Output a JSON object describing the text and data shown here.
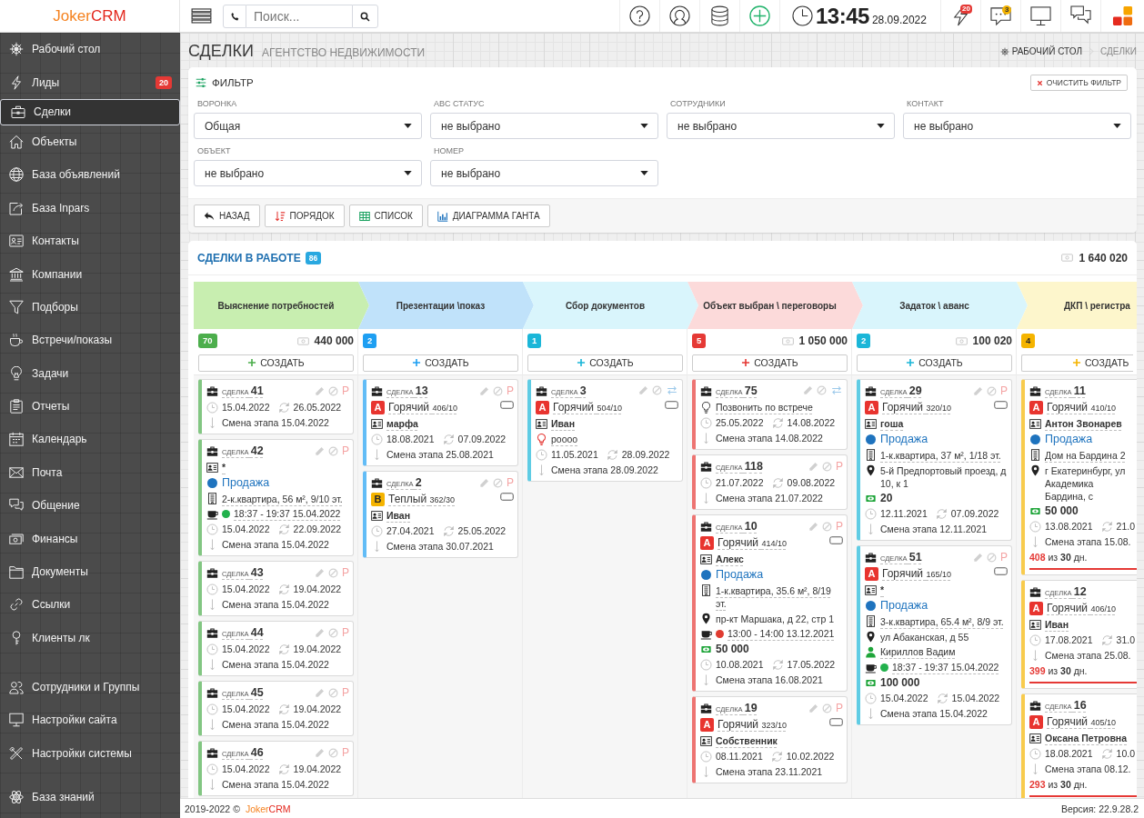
{
  "topbar": {
    "logo": [
      "Joker",
      "CRM"
    ],
    "search": {
      "placeholder": "Поиск..."
    },
    "clock": {
      "time": "13:45",
      "date": "28.09.2022"
    },
    "leads_badge": "20",
    "messages_badge": "3"
  },
  "sidebar": {
    "items": [
      {
        "label": "Рабочий стол",
        "selected": false
      },
      {
        "label": "Лиды",
        "selected": false,
        "badge": "20"
      },
      {
        "label": "Сделки",
        "selected": true
      },
      {
        "label": "Объекты",
        "selected": false
      },
      {
        "label": "База объявлений",
        "selected": false
      },
      {
        "label": "База Inpars",
        "selected": false
      },
      {
        "label": "Контакты",
        "selected": false
      },
      {
        "label": "Компании",
        "selected": false
      },
      {
        "label": "Подборы",
        "selected": false
      },
      {
        "label": "Встречи/показы",
        "selected": false
      },
      {
        "label": "Задачи",
        "selected": false
      },
      {
        "label": "Отчеты",
        "selected": false
      },
      {
        "label": "Календарь",
        "selected": false
      },
      {
        "label": "Почта",
        "selected": false
      },
      {
        "label": "Общение",
        "selected": false
      },
      {
        "label": "Финансы",
        "selected": false
      },
      {
        "label": "Документы",
        "selected": false
      },
      {
        "label": "Ссылки",
        "selected": false
      },
      {
        "label": "Клиенты лк",
        "selected": false
      }
    ],
    "admin_items": [
      {
        "label": "Сотрудники и Группы",
        "selected": false
      },
      {
        "label": "Настройки сайта",
        "selected": false
      },
      {
        "label": "Настройки системы",
        "selected": false
      }
    ],
    "bottom_items": [
      {
        "label": "База знаний",
        "selected": false
      }
    ]
  },
  "page": {
    "title": "СДЕЛКИ",
    "subtitle": "АГЕНТСТВО НЕДВИЖИМОСТИ",
    "breadcrumbs": [
      {
        "label": "РАБОЧИЙ СТОЛ",
        "current": false
      },
      {
        "label": "СДЕЛКИ",
        "current": true
      }
    ]
  },
  "filter": {
    "title": "ФИЛЬТР",
    "clear": "ОЧИСТИТЬ ФИЛЬТР",
    "fields": [
      {
        "label": "ВОРОНКА",
        "value": "Общая"
      },
      {
        "label": "ABC СТАТУС",
        "value": "не выбрано"
      },
      {
        "label": "СОТРУДНИКИ",
        "value": "не выбрано"
      },
      {
        "label": "КОНТАКТ",
        "value": "не выбрано"
      },
      {
        "label": "ОБЪЕКТ",
        "value": "не выбрано"
      },
      {
        "label": "НОМЕР",
        "value": "не выбрано"
      }
    ],
    "buttons": [
      "НАЗАД",
      "ПОРЯДОК",
      "СПИСОК",
      "ДИАГРАММА ГАНТА"
    ]
  },
  "deals": {
    "title": "СДЕЛКИ В РАБОТЕ",
    "count": "86",
    "total": "1 640 020",
    "stages": [
      {
        "name": "Выяснение потребностей",
        "color": "#c8eeb0",
        "count": {
          "text": "70",
          "color": "#4cae4c"
        },
        "total": "440 000",
        "create": "СОЗДАТЬ",
        "cards": [
          {
            "title": "СДЕЛКА",
            "number": "41",
            "actions": {
              "flag": "P"
            },
            "rows": [
              {
                "kind": "dates",
                "created": "15.04.2022",
                "updated": "26.05.2022"
              },
              {
                "kind": "stage",
                "text": "Смена этапа 15.04.2022"
              }
            ]
          },
          {
            "title": "СДЕЛКА",
            "number": "42",
            "actions": {
              "flag": "P"
            },
            "rows": [
              {
                "kind": "contact",
                "text": "*"
              },
              {
                "kind": "type",
                "text": "Продажа"
              },
              {
                "kind": "object",
                "text": "2-к.квартира, 56 м², 9/10 эт."
              },
              {
                "kind": "meeting",
                "text": "18:37 - 19:37 15.04.2022",
                "color": "#22b14c"
              },
              {
                "kind": "dates",
                "created": "15.04.2022",
                "updated": "22.09.2022"
              },
              {
                "kind": "stage",
                "text": "Смена этапа 15.04.2022"
              }
            ]
          },
          {
            "title": "СДЕЛКА",
            "number": "43",
            "actions": {
              "flag": "P"
            },
            "rows": [
              {
                "kind": "dates",
                "created": "15.04.2022",
                "updated": "19.04.2022"
              },
              {
                "kind": "stage",
                "text": "Смена этапа 15.04.2022"
              }
            ]
          },
          {
            "title": "СДЕЛКА",
            "number": "44",
            "actions": {
              "flag": "P"
            },
            "rows": [
              {
                "kind": "dates",
                "created": "15.04.2022",
                "updated": "19.04.2022"
              },
              {
                "kind": "stage",
                "text": "Смена этапа 15.04.2022"
              }
            ]
          },
          {
            "title": "СДЕЛКА",
            "number": "45",
            "actions": {
              "flag": "P"
            },
            "rows": [
              {
                "kind": "dates",
                "created": "15.04.2022",
                "updated": "19.04.2022"
              },
              {
                "kind": "stage",
                "text": "Смена этапа 15.04.2022"
              }
            ]
          },
          {
            "title": "СДЕЛКА",
            "number": "46",
            "actions": {
              "flag": "P"
            },
            "rows": [
              {
                "kind": "dates",
                "created": "15.04.2022",
                "updated": "19.04.2022"
              },
              {
                "kind": "stage",
                "text": "Смена этапа 15.04.2022"
              }
            ]
          }
        ]
      },
      {
        "name": "Презентации \\показ",
        "color": "#c0e2fa",
        "count": {
          "text": "2",
          "color": "#1e9ff2"
        },
        "create": "СОЗДАТЬ",
        "cards": [
          {
            "title": "СДЕЛКА",
            "number": "13",
            "actions": {
              "flag": "P"
            },
            "rows": [
              {
                "kind": "rating",
                "grade": "A",
                "label": "Горячий",
                "score": "406/10",
                "color": "#e8342f",
                "tag": true
              },
              {
                "kind": "contact",
                "text": "марфа"
              },
              {
                "kind": "dates",
                "created": "18.08.2021",
                "updated": "07.09.2022"
              },
              {
                "kind": "stage",
                "text": "Смена этапа 25.08.2021"
              }
            ]
          },
          {
            "title": "СДЕЛКА",
            "number": "2",
            "actions": {
              "flag": "P"
            },
            "rows": [
              {
                "kind": "rating",
                "grade": "B",
                "label": "Теплый",
                "score": "362/30",
                "color": "#f5b400",
                "tag": true
              },
              {
                "kind": "contact",
                "text": "Иван"
              },
              {
                "kind": "dates",
                "created": "27.04.2021",
                "updated": "25.05.2022"
              },
              {
                "kind": "stage",
                "text": "Смена этапа 30.07.2021"
              }
            ]
          }
        ]
      },
      {
        "name": "Сбор документов",
        "color": "#d9f5fc",
        "count": {
          "text": "1",
          "color": "#1bb6d8"
        },
        "create": "СОЗДАТЬ",
        "cards": [
          {
            "title": "СДЕЛКА",
            "number": "3",
            "actions": {
              "transfer": true
            },
            "rows": [
              {
                "kind": "rating",
                "grade": "A",
                "label": "Горячий",
                "score": "504/10",
                "color": "#e8342f",
                "tag": true
              },
              {
                "kind": "contact",
                "text": "Иван"
              },
              {
                "kind": "task",
                "text": "роооо",
                "overdue": true
              },
              {
                "kind": "dates",
                "created": "11.05.2021",
                "updated": "28.09.2022"
              },
              {
                "kind": "stage",
                "text": "Смена этапа 28.09.2022"
              }
            ]
          }
        ]
      },
      {
        "name": "Объект выбран \\ переговоры",
        "color": "#fcdada",
        "count": {
          "text": "5",
          "color": "#e53935"
        },
        "total": "1 050 000",
        "create": "СОЗДАТЬ",
        "cards": [
          {
            "title": "СДЕЛКА",
            "number": "75",
            "actions": {
              "transfer": true
            },
            "rows": [
              {
                "kind": "task",
                "text": "Позвонить по встрече",
                "overdue": false
              },
              {
                "kind": "dates",
                "created": "25.05.2022",
                "updated": "14.08.2022"
              },
              {
                "kind": "stage",
                "text": "Смена этапа 14.08.2022"
              }
            ]
          },
          {
            "title": "СДЕЛКА",
            "number": "118",
            "actions": {
              "flag": "P"
            },
            "rows": [
              {
                "kind": "dates",
                "created": "21.07.2022",
                "updated": "09.08.2022"
              },
              {
                "kind": "stage",
                "text": "Смена этапа 21.07.2022"
              }
            ]
          },
          {
            "title": "СДЕЛКА",
            "number": "10",
            "actions": {
              "flag": "P"
            },
            "rows": [
              {
                "kind": "rating",
                "grade": "A",
                "label": "Горячий",
                "score": "414/10",
                "color": "#e8342f",
                "tag": true
              },
              {
                "kind": "contact",
                "text": "Алекс"
              },
              {
                "kind": "type",
                "text": "Продажа"
              },
              {
                "kind": "object",
                "text": "1-к.квартира, 35.6 м², 8/19 эт."
              },
              {
                "kind": "address",
                "text": "пр-кт Маршака, д 22, стр 1"
              },
              {
                "kind": "meeting",
                "text": "13:00 - 14:00 13.12.2021",
                "color": "#e03c31"
              },
              {
                "kind": "money",
                "text": "50 000"
              },
              {
                "kind": "dates",
                "created": "10.08.2021",
                "updated": "17.05.2022"
              },
              {
                "kind": "stage",
                "text": "Смена этапа 16.08.2021"
              }
            ]
          },
          {
            "title": "СДЕЛКА",
            "number": "19",
            "actions": {
              "flag": "P"
            },
            "rows": [
              {
                "kind": "rating",
                "grade": "A",
                "label": "Горячий",
                "score": "323/10",
                "color": "#e8342f",
                "tag": true
              },
              {
                "kind": "contact",
                "text": "Собственник"
              },
              {
                "kind": "dates",
                "created": "08.11.2021",
                "updated": "10.02.2022"
              },
              {
                "kind": "stage",
                "text": "Смена этапа 23.11.2021"
              }
            ]
          }
        ]
      },
      {
        "name": "Задаток \\ аванс",
        "color": "#d9f5fc",
        "count": {
          "text": "2",
          "color": "#1bb6d8"
        },
        "total": "100 020",
        "create": "СОЗДАТЬ",
        "cards": [
          {
            "title": "СДЕЛКА",
            "number": "29",
            "actions": {
              "flag": "P"
            },
            "rows": [
              {
                "kind": "rating",
                "grade": "A",
                "label": "Горячий",
                "score": "320/10",
                "color": "#e8342f",
                "tag": true
              },
              {
                "kind": "contact",
                "text": "гоша"
              },
              {
                "kind": "type",
                "text": "Продажа"
              },
              {
                "kind": "object",
                "text": "1-к.квартира, 37 м², 1/18 эт."
              },
              {
                "kind": "address",
                "text": "5-й Предпортовый проезд, д 10, к 1"
              },
              {
                "kind": "money",
                "text": "20"
              },
              {
                "kind": "dates",
                "created": "12.11.2021",
                "updated": "07.09.2022"
              },
              {
                "kind": "stage",
                "text": "Смена этапа 12.11.2021"
              }
            ]
          },
          {
            "title": "СДЕЛКА",
            "number": "51",
            "actions": {
              "flag": "P"
            },
            "rows": [
              {
                "kind": "rating",
                "grade": "A",
                "label": "Горячий",
                "score": "165/10",
                "color": "#e8342f",
                "tag": true
              },
              {
                "kind": "contact",
                "text": "*"
              },
              {
                "kind": "type",
                "text": "Продажа"
              },
              {
                "kind": "object",
                "text": "3-к.квартира, 65.4 м², 8/9 эт."
              },
              {
                "kind": "address",
                "text": "ул Абаканская, д 55"
              },
              {
                "kind": "agent",
                "text": "Кириллов Вадим"
              },
              {
                "kind": "meeting",
                "text": "18:37 - 19:37 15.04.2022",
                "color": "#22b14c"
              },
              {
                "kind": "money",
                "text": "100 000"
              },
              {
                "kind": "dates",
                "created": "15.04.2022",
                "updated": "15.04.2022"
              },
              {
                "kind": "stage",
                "text": "Смена этапа 15.04.2022"
              }
            ]
          }
        ]
      },
      {
        "name": "ДКП \\ регистра",
        "color": "#fdf6cc",
        "count": {
          "text": "4",
          "color": "#f5b400"
        },
        "create": "СОЗДАТЬ",
        "cards": [
          {
            "title": "СДЕЛКА",
            "number": "11",
            "rows": [
              {
                "kind": "rating",
                "grade": "A",
                "label": "Горячий",
                "score": "410/10",
                "color": "#e8342f"
              },
              {
                "kind": "contact",
                "text": "Антон Звонарев"
              },
              {
                "kind": "type",
                "text": "Продажа"
              },
              {
                "kind": "object",
                "text": "Дом на Бардина 2"
              },
              {
                "kind": "address",
                "text": "г Екатеринбург, ул Академика Бардина, с"
              },
              {
                "kind": "money",
                "text": "50 000"
              },
              {
                "kind": "dates",
                "created": "13.08.2021",
                "updated": "21.0"
              },
              {
                "kind": "stage",
                "text": "Смена этапа 15.08."
              },
              {
                "kind": "days",
                "days": "408",
                "sep": "из",
                "limit": "30",
                "unit": "дн.",
                "overdue": true
              }
            ]
          },
          {
            "title": "СДЕЛКА",
            "number": "12",
            "rows": [
              {
                "kind": "rating",
                "grade": "A",
                "label": "Горячий",
                "score": "406/10",
                "color": "#e8342f"
              },
              {
                "kind": "contact",
                "text": "Иван"
              },
              {
                "kind": "dates",
                "created": "17.08.2021",
                "updated": "31.0"
              },
              {
                "kind": "stage",
                "text": "Смена этапа 25.08."
              },
              {
                "kind": "days",
                "days": "399",
                "sep": "из",
                "limit": "30",
                "unit": "дн.",
                "overdue": true
              }
            ]
          },
          {
            "title": "СДЕЛКА",
            "number": "16",
            "rows": [
              {
                "kind": "rating",
                "grade": "A",
                "label": "Горячий",
                "score": "405/10",
                "color": "#e8342f"
              },
              {
                "kind": "contact",
                "text": "Оксана Петровна"
              },
              {
                "kind": "dates",
                "created": "18.08.2021",
                "updated": "10.0"
              },
              {
                "kind": "stage",
                "text": "Смена этапа 08.12."
              },
              {
                "kind": "days",
                "days": "293",
                "sep": "из",
                "limit": "30",
                "unit": "дн.",
                "overdue": true
              }
            ]
          }
        ]
      }
    ]
  },
  "footer": {
    "copyright": "2019-2022 ©",
    "brand": [
      "Joker",
      "CRM"
    ],
    "version": "Версия: 22.9.28.2"
  }
}
